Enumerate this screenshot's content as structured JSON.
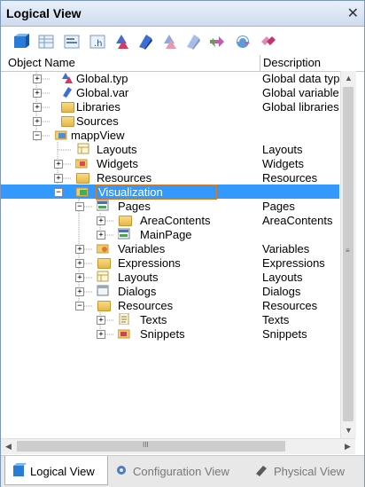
{
  "window": {
    "title": "Logical View",
    "close_glyph": "✕"
  },
  "toolbar": {
    "icons": [
      "package-icon",
      "table-icon",
      "structure-icon",
      "header-icon",
      "datatype-icon",
      "variable-icon",
      "open-icon",
      "edit-icon",
      "move-icon",
      "refresh-icon",
      "delete-icon"
    ]
  },
  "columns": {
    "name": "Object Name",
    "description": "Description"
  },
  "tree": [
    {
      "name": "Global.typ",
      "desc": "Global data typ"
    },
    {
      "name": "Global.var",
      "desc": "Global variable"
    },
    {
      "name": "Libraries",
      "desc": "Global libraries"
    },
    {
      "name": "Sources",
      "desc": ""
    },
    {
      "name": "mappView",
      "desc": ""
    },
    {
      "name": "Layouts",
      "desc": "Layouts"
    },
    {
      "name": "Widgets",
      "desc": "Widgets"
    },
    {
      "name": "Resources",
      "desc": "Resources"
    },
    {
      "name": "Visualization",
      "desc": ""
    },
    {
      "name": "Pages",
      "desc": "Pages"
    },
    {
      "name": "AreaContents",
      "desc": "AreaContents"
    },
    {
      "name": "MainPage",
      "desc": ""
    },
    {
      "name": "Variables",
      "desc": "Variables"
    },
    {
      "name": "Expressions",
      "desc": "Expressions"
    },
    {
      "name": "Layouts",
      "desc": "Layouts"
    },
    {
      "name": "Dialogs",
      "desc": "Dialogs"
    },
    {
      "name": "Resources",
      "desc": "Resources"
    },
    {
      "name": "Texts",
      "desc": "Texts"
    },
    {
      "name": "Snippets",
      "desc": "Snippets"
    }
  ],
  "scrollbar": {
    "grip": "III"
  },
  "tabs": [
    {
      "label": "Logical View",
      "active": true
    },
    {
      "label": "Configuration View",
      "active": false
    },
    {
      "label": "Physical View",
      "active": false
    }
  ]
}
